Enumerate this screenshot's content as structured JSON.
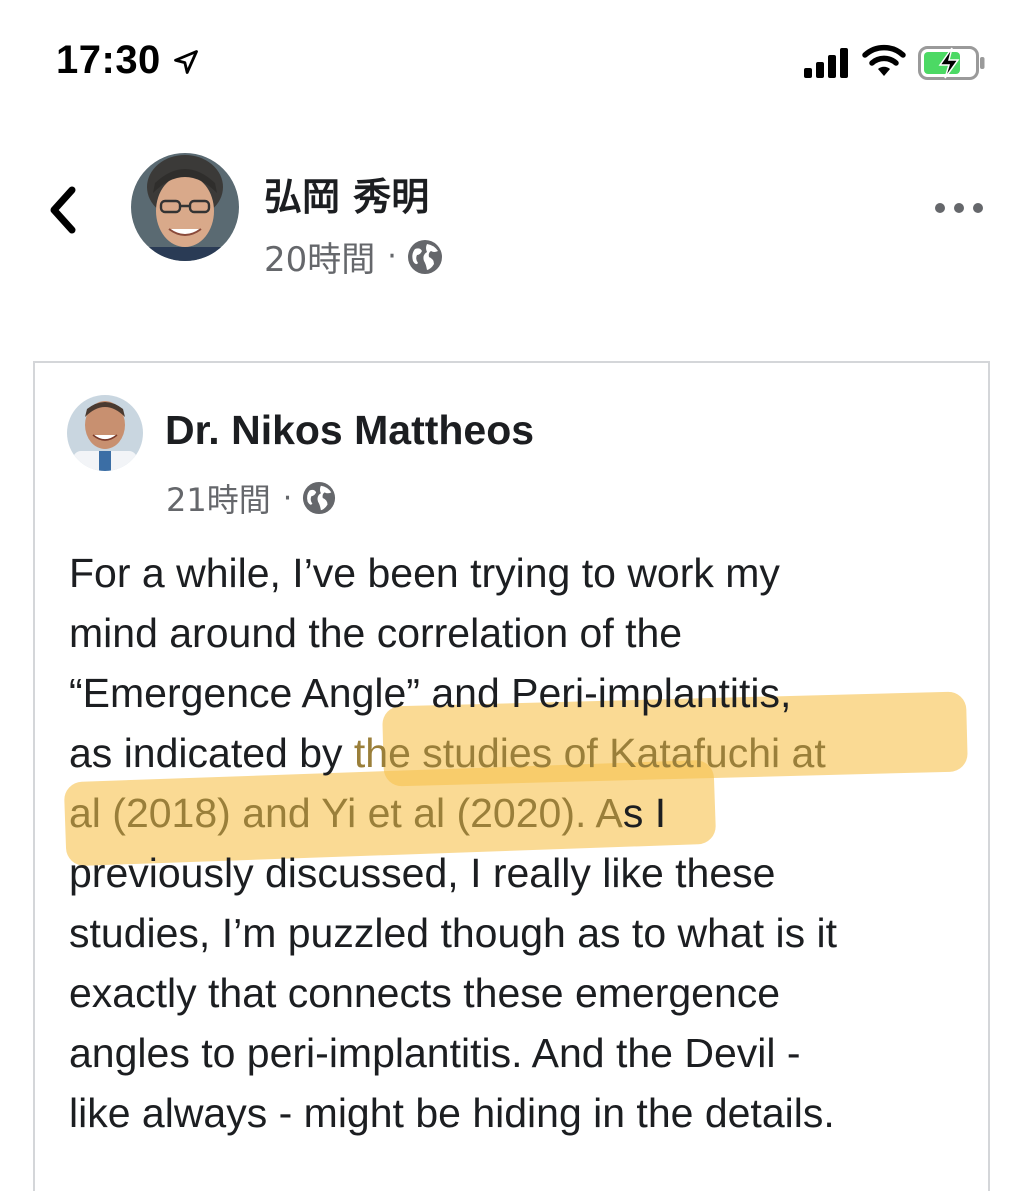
{
  "status_bar": {
    "time": "17:30",
    "icons": [
      "location-arrow-icon",
      "cellular-signal-icon",
      "wifi-icon",
      "battery-charging-icon"
    ],
    "battery_color": "#4cd964"
  },
  "header": {
    "back_icon": "chevron-left-icon",
    "author_name": "弘岡 秀明",
    "time_ago": "20時間",
    "separator": "·",
    "privacy_icon": "globe-icon",
    "more_icon": "ellipsis-icon"
  },
  "shared_post": {
    "author_name": "Dr. Nikos Mattheos",
    "time_ago": "21時間",
    "separator": "·",
    "privacy_icon": "globe-icon",
    "body_lines": [
      "For a while, I’ve been trying to work my",
      "mind around the correlation of the",
      "“Emergence Angle” and Peri-implantitis,",
      "as indicated by ",
      "the studies of Katafuchi at",
      "al (2018) and Yi et al (2020). A",
      "s I",
      "previously discussed, I really like these",
      "studies, I’m puzzled though as to what is it",
      "exactly that connects these emergence",
      "angles to peri-implantitis. And the Devil -",
      "like always - might be hiding in the details."
    ],
    "highlighted_text": "the studies of Katafuchi at al (2018) and Yi et al (2020). A",
    "highlight_color": "#f7c452"
  }
}
